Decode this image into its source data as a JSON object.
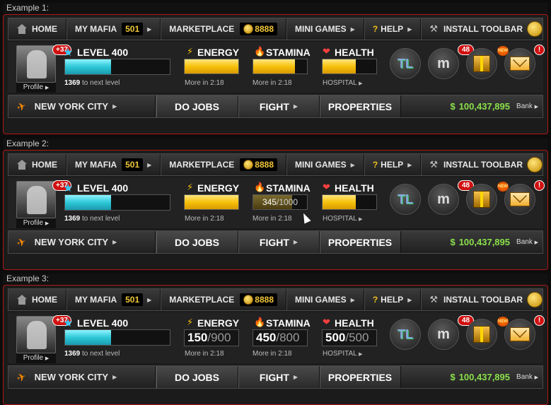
{
  "examples": [
    {
      "label": "Example 1:",
      "variant": "bars"
    },
    {
      "label": "Example 2:",
      "variant": "hover"
    },
    {
      "label": "Example 3:",
      "variant": "numbers"
    }
  ],
  "topbar": {
    "home": "HOME",
    "my_mafia": "MY MAFIA",
    "mafia_count": "501",
    "marketplace": "MARKETPLACE",
    "coins": "8888",
    "mini_games": "MINI GAMES",
    "help": "HELP",
    "install_toolbar": "INSTALL TOOLBAR"
  },
  "player": {
    "notification_count": "+37",
    "profile": "Profile",
    "level": "LEVEL 400",
    "xp_to_next": "1369",
    "xp_suffix": "to next level",
    "xp_fraction": 0.44
  },
  "stats": {
    "energy": {
      "title": "ENERGY",
      "current": "150",
      "max": "/900",
      "sub": "More in 2:18",
      "fraction": 1.0
    },
    "stamina": {
      "title": "STAMINA",
      "current": "450",
      "max": "/800",
      "sub": "More in 2:18",
      "fraction": 0.78,
      "hover_current": "345",
      "hover_max": "/1000",
      "hover_fraction": 0.72
    },
    "health": {
      "title": "HEALTH",
      "current": "500",
      "max": "/500",
      "sub": "HOSPITAL",
      "fraction": 0.62
    }
  },
  "right_icons": {
    "mail_badge": "48",
    "new_badge": "NEW",
    "alert_badge": "!"
  },
  "nav": {
    "city": "NEW YORK CITY",
    "do_jobs": "DO JOBS",
    "fight": "FIGHT",
    "properties": "PROPERTIES",
    "cash": "100,437,895",
    "bank": "Bank"
  },
  "colors": {
    "frame": "#b01818",
    "xp": "#2dc8d8",
    "bar": "#f7c10c",
    "cash": "#8be04a"
  }
}
